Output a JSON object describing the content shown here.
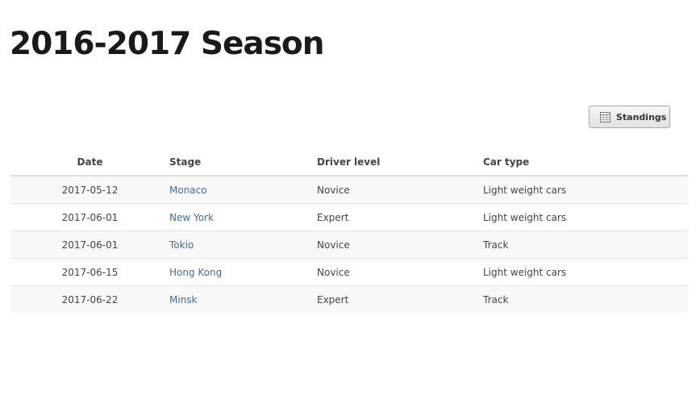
{
  "page": {
    "title": "2016-2017 Season"
  },
  "toolbar": {
    "standings_label": "Standings",
    "standings_icon": "table-icon"
  },
  "table": {
    "headers": {
      "date": "Date",
      "stage": "Stage",
      "driver_level": "Driver level",
      "car_type": "Car type"
    },
    "rows": [
      {
        "date": "2017-05-12",
        "stage": "Monaco",
        "driver_level": "Novice",
        "car_type": "Light weight cars"
      },
      {
        "date": "2017-06-01",
        "stage": "New York",
        "driver_level": "Expert",
        "car_type": "Light weight cars"
      },
      {
        "date": "2017-06-01",
        "stage": "Tokio",
        "driver_level": "Novice",
        "car_type": "Track"
      },
      {
        "date": "2017-06-15",
        "stage": "Hong Kong",
        "driver_level": "Novice",
        "car_type": "Light weight cars"
      },
      {
        "date": "2017-06-22",
        "stage": "Minsk",
        "driver_level": "Expert",
        "car_type": "Track"
      }
    ]
  },
  "colors": {
    "link": "#3a6fa5",
    "title": "#1a1a1a",
    "row_stripe": "#f8f8f8"
  }
}
